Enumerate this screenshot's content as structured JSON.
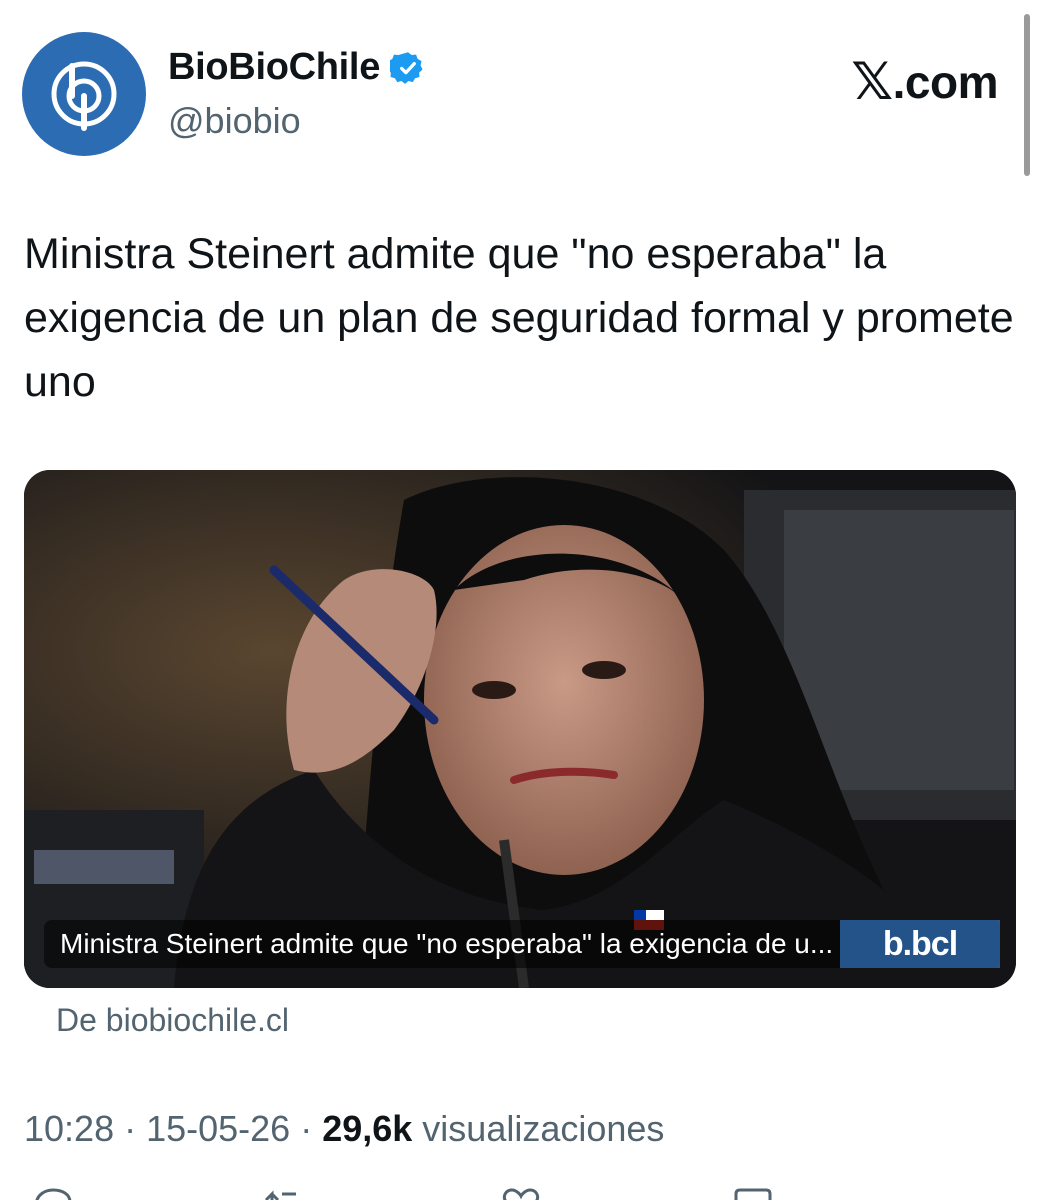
{
  "account": {
    "display_name": "BioBioChile",
    "handle": "@biobio",
    "verified": true,
    "avatar_color": "#2c6cb3",
    "verified_color": "#1d9bf0"
  },
  "brand": {
    "site_label": ".com",
    "x_glyph": "𝕏"
  },
  "tweet": {
    "text": "Ministra Steinert admite que \"no esperaba\" la exigencia de un plan de seguridad formal y promete uno"
  },
  "card": {
    "caption": "Ministra Steinert admite que \"no esperaba\" la exigencia de u...",
    "watermark": "b.bcl",
    "source": "De biobiochile.cl"
  },
  "meta": {
    "time": "10:28",
    "date": "15-05-26",
    "separator": "·",
    "views_count": "29,6k",
    "views_label": "visualizaciones"
  },
  "icons": {
    "verified": "verified-badge-icon",
    "reply": "reply-icon",
    "retweet": "retweet-icon",
    "like": "heart-icon",
    "bookmark": "bookmark-icon"
  }
}
